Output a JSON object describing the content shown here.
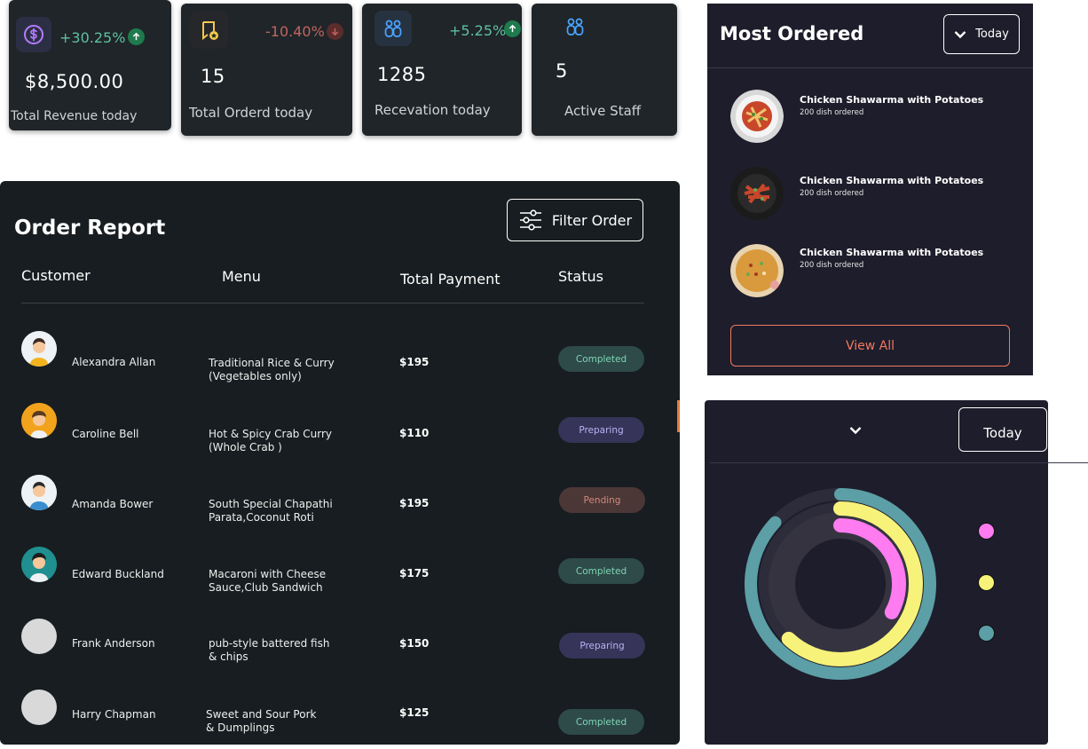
{
  "colors": {
    "card_bg": "#1f2528",
    "panel_bg": "#1e1d2b",
    "positive": "#5fc0a0",
    "negative": "#c06462",
    "accent_orange": "#f2785f",
    "ring_pink": "#ff7bf0",
    "ring_yellow": "#f7f27a",
    "ring_teal": "#5c9fa6"
  },
  "stats": [
    {
      "icon": "dollar-icon",
      "change": "+30.25%",
      "trend": "up",
      "value": "$8,500.00",
      "label": "Total Revenue today"
    },
    {
      "icon": "order-badge-icon",
      "change": "-10.40%",
      "trend": "down",
      "value": "15",
      "label": "Total Orderd today"
    },
    {
      "icon": "reservation-icon",
      "change": "+5.25%",
      "trend": "up",
      "value": "1285",
      "label": "Recevation today"
    },
    {
      "icon": "staff-icon",
      "change": "",
      "trend": "",
      "value": "5",
      "label": "Active Staff"
    }
  ],
  "order_report": {
    "title": "Order Report",
    "filter_label": "Filter Order",
    "columns": [
      "Customer",
      "Menu",
      "Total Payment",
      "Status"
    ],
    "rows": [
      {
        "customer": "Alexandra Allan",
        "menu_line1": "Traditional Rice & Curry",
        "menu_line2": "(Vegetables only)",
        "payment": "$195",
        "status": "Completed"
      },
      {
        "customer": "Caroline Bell",
        "menu_line1": "Hot & Spicy Crab Curry",
        "menu_line2": "(Whole Crab )",
        "payment": "$110",
        "status": "Preparing"
      },
      {
        "customer": "Amanda Bower",
        "menu_line1": "South Special Chapathi",
        "menu_line2": "Parata,Coconut Roti",
        "payment": "$195",
        "status": "Pending"
      },
      {
        "customer": "Edward Buckland",
        "menu_line1": "Macaroni with Cheese",
        "menu_line2": "Sauce,Club Sandwich",
        "payment": "$175",
        "status": "Completed"
      },
      {
        "customer": "Frank Anderson",
        "menu_line1": "pub-style battered fish",
        "menu_line2": "& chips",
        "payment": "$150",
        "status": "Preparing"
      },
      {
        "customer": "Harry Chapman",
        "menu_line1": "Sweet and Sour Pork",
        "menu_line2": "& Dumplings",
        "payment": "$125",
        "status": "Completed"
      }
    ]
  },
  "most_ordered": {
    "title": "Most Ordered",
    "period": "Today",
    "items": [
      {
        "name": "Chicken Shawarma with Potatoes",
        "sub": "200 dish ordered"
      },
      {
        "name": "Chicken Shawarma with Potatoes",
        "sub": "200 dish ordered"
      },
      {
        "name": "Chicken Shawarma with Potatoes",
        "sub": "200 dish ordered"
      }
    ],
    "view_all": "View All"
  },
  "ring_chart": {
    "period": "Today",
    "rings": [
      {
        "color": "#5c9fa6",
        "fraction": 0.87
      },
      {
        "color": "#f7f27a",
        "fraction": 0.62
      },
      {
        "color": "#ff7bf0",
        "fraction": 0.33
      }
    ],
    "legend_colors": [
      "#ff7bf0",
      "#f7f27a",
      "#5c9fa6"
    ]
  }
}
